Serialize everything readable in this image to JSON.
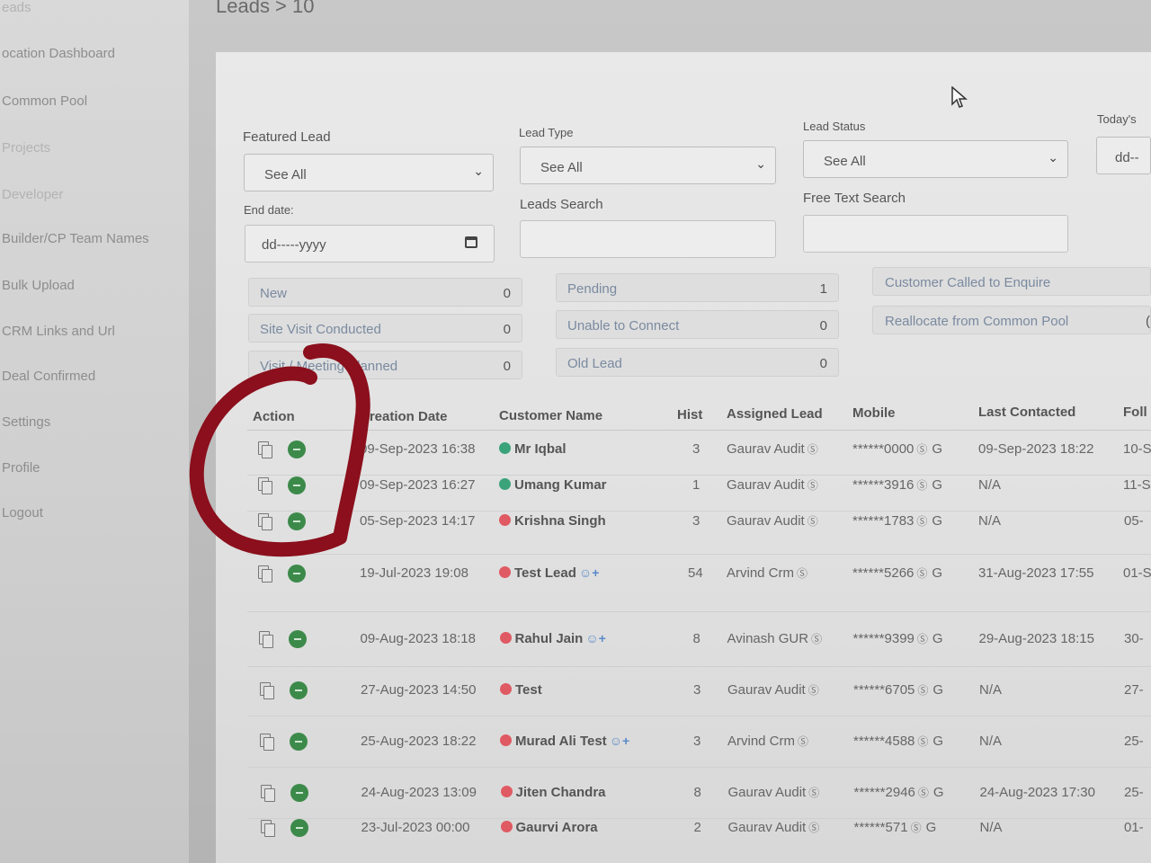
{
  "sidebar": {
    "items": [
      {
        "label": "eads"
      },
      {
        "label": "ocation Dashboard"
      },
      {
        "label": "Common Pool"
      },
      {
        "label": "Projects"
      },
      {
        "label": "Developer"
      },
      {
        "label": "Builder/CP Team Names"
      },
      {
        "label": "Bulk Upload"
      },
      {
        "label": "CRM Links and Url"
      },
      {
        "label": "Deal Confirmed"
      },
      {
        "label": "Settings"
      },
      {
        "label": "Profile"
      },
      {
        "label": "Logout"
      }
    ]
  },
  "header": {
    "breadcrumb": "Leads > 10"
  },
  "filters": {
    "featured_lead": {
      "label": "Featured Lead",
      "value": "See All"
    },
    "lead_type": {
      "label": "Lead Type",
      "value": "See All"
    },
    "lead_status": {
      "label": "Lead Status",
      "value": "See All"
    },
    "todays": {
      "label": "Today's",
      "value": "dd--"
    },
    "end_date": {
      "label": "End date:",
      "value": "dd-----yyyy"
    },
    "leads_search": {
      "label": "Leads Search",
      "value": ""
    },
    "free_text_search": {
      "label": "Free Text Search",
      "value": ""
    }
  },
  "status_counts": [
    {
      "label": "New",
      "count": "0"
    },
    {
      "label": "Site Visit Conducted",
      "count": "0"
    },
    {
      "label": "Visit / Meeting Planned",
      "count": "0"
    },
    {
      "label": "Pending",
      "count": "1"
    },
    {
      "label": "Unable to Connect",
      "count": "0"
    },
    {
      "label": "Old Lead",
      "count": "0"
    },
    {
      "label": "Customer Called to Enquire",
      "count": ""
    },
    {
      "label": "Reallocate from Common Pool",
      "count": "("
    }
  ],
  "table": {
    "columns": [
      "Action",
      "Creation Date",
      "Customer Name",
      "Hist",
      "Assigned Lead",
      "Mobile",
      "Last Contacted",
      "Foll"
    ],
    "rows": [
      {
        "date": "09-Sep-2023 16:38",
        "name": "Mr Iqbal",
        "status_color": "#3aa37a",
        "hist": "3",
        "assigned": "Gaurav Audit",
        "mobile": "******0000",
        "last": "09-Sep-2023 18:22",
        "foll": "10-S",
        "person": false
      },
      {
        "date": "09-Sep-2023 16:27",
        "name": "Umang Kumar",
        "status_color": "#3aa37a",
        "hist": "1",
        "assigned": "Gaurav Audit",
        "mobile": "******3916",
        "last": "N/A",
        "foll": "11-S",
        "person": false
      },
      {
        "date": "05-Sep-2023 14:17",
        "name": "Krishna Singh",
        "status_color": "#e05a63",
        "hist": "3",
        "assigned": "Gaurav Audit",
        "mobile": "******1783",
        "last": "N/A",
        "foll": "05-",
        "person": false
      },
      {
        "date": "19-Jul-2023 19:08",
        "name": "Test Lead",
        "status_color": "#e05a63",
        "hist": "54",
        "assigned": "Arvind Crm",
        "mobile": "******5266",
        "last": "31-Aug-2023 17:55",
        "foll": "01-S",
        "person": true
      },
      {
        "date": "09-Aug-2023 18:18",
        "name": "Rahul Jain",
        "status_color": "#e05a63",
        "hist": "8",
        "assigned": "Avinash GUR",
        "mobile": "******9399",
        "last": "29-Aug-2023 18:15",
        "foll": "30-",
        "person": true
      },
      {
        "date": "27-Aug-2023 14:50",
        "name": "Test",
        "status_color": "#e05a63",
        "hist": "3",
        "assigned": "Gaurav Audit",
        "mobile": "******6705",
        "last": "N/A",
        "foll": "27-",
        "person": false
      },
      {
        "date": "25-Aug-2023 18:22",
        "name": "Murad Ali Test",
        "status_color": "#e05a63",
        "hist": "3",
        "assigned": "Arvind Crm",
        "mobile": "******4588",
        "last": "N/A",
        "foll": "25-",
        "person": true
      },
      {
        "date": "24-Aug-2023 13:09",
        "name": "Jiten Chandra",
        "status_color": "#e05a63",
        "hist": "8",
        "assigned": "Gaurav Audit",
        "mobile": "******2946",
        "last": "24-Aug-2023 17:30",
        "foll": "25-",
        "person": false
      },
      {
        "date": "23-Jul-2023 00:00",
        "name": "Gaurvi Arora",
        "status_color": "#e05a63",
        "hist": "2",
        "assigned": "Gaurav Audit",
        "mobile": "******571",
        "last": "N/A",
        "foll": "01-",
        "person": false
      }
    ]
  },
  "icons": {
    "whatsapp": "Ⓢ",
    "google": "G",
    "chevron": "⌄",
    "person_add": "☺+"
  },
  "colors": {
    "annotation_circle": "#8b0f1c",
    "action_green": "#3c8a4a"
  }
}
